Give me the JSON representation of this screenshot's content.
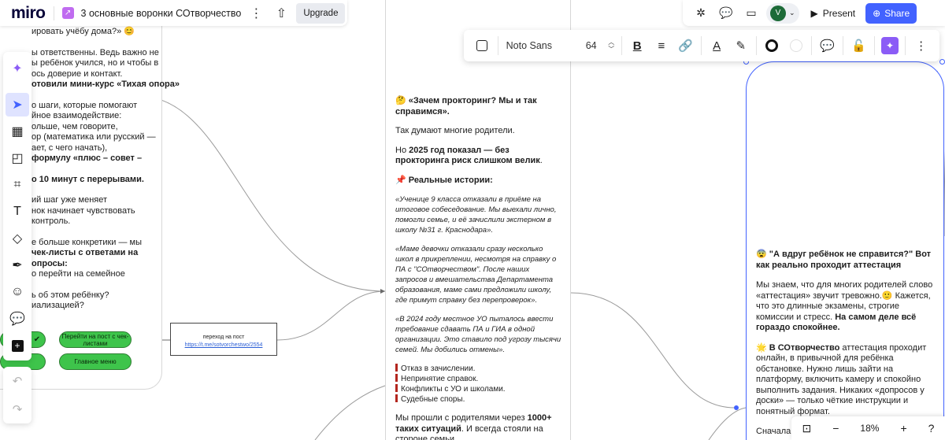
{
  "header": {
    "logo": "miro",
    "board_title": "3 основные воронки СОтворчество",
    "upgrade_label": "Upgrade"
  },
  "topbar": {
    "avatar_initial": "V",
    "present_label": "Present",
    "share_label": "Share"
  },
  "format_toolbar": {
    "font_name": "Noto Sans",
    "font_size": "64"
  },
  "canvas": {
    "left_card": {
      "lines": [
        "ировать учёбу дома?» 😊",
        "ы ответственны. Ведь важно не",
        "ы ребёнок учился, но и чтобы в",
        "ось доверие и контакт.",
        "отовили мини-курс «Тихая опора»",
        "о шаги, которые помогают",
        "йное взаимодействие:",
        "ольше, чем говорите,",
        "ор (математика или русский —",
        "ает, с чего начать),",
        "формулу «плюс – совет –",
        "о 10 минут с перерывами.",
        "ий шаг уже меняет",
        "нок начинает чувствовать",
        "контроль.",
        "е больше конкретики — мы",
        "чек-листы с ответами на",
        "опросы:",
        "о перейти на семейное",
        "ь об этом ребёнку?",
        "иализацией?"
      ],
      "btn_checklists": "Перейти на пост с чек-листами",
      "btn_main_menu": "Главное меню"
    },
    "link_box": {
      "label": "переход на пост",
      "url": "https://t.me/sotvorchestwo/2554"
    },
    "mid_card": {
      "heading": "🤔 «Зачем прокторинг? Мы и так справимся».",
      "p1": "Так думают многие родители.",
      "p2_prefix": "Но ",
      "p2_bold": "2025 год показал — без прокторинга риск слишком велик",
      "p2_suffix": ".",
      "stories_heading": "📌 Реальные истории:",
      "story1": "«Ученице 9 класса отказали в приёме на итоговое собеседование. Мы выехали лично, помогли семье, и её зачислили экстерном в школу №31 г. Краснодара».",
      "story2": "«Маме девочки отказали сразу несколько школ в прикреплении, несмотря на справку о ПА с \"СОтворчеством\". После наших запросов и вмешательства Департамента образования, маме сами предложили школу, где примут справку без перепроверок».",
      "story3": "«В 2024 году местное УО пыталось ввести требование сдавать ПА и ГИА в одной организации. Это ставило под угрозу тысячи семей. Мы добились отмены».",
      "list": [
        "Отказ в зачислении.",
        "Непринятие справок.",
        "Конфликты с УО и школами.",
        "Судебные споры."
      ],
      "closing_prefix": "Мы прошли с родителями через ",
      "closing_bold": "1000+ таких ситуаций",
      "closing_suffix": ". И всегда стояли на стороне семьи."
    },
    "right_card": {
      "heading": "😨 \"А вдруг ребёнок не справится?\" Вот как реально проходит аттестация",
      "p1": " Мы знаем, что для многих родителей слово «аттестация» звучит тревожно.🙂 Кажется, что это длинные экзамены, строгие комиссии и стресс. ",
      "p1_bold": "На самом деле всё гораздо спокойнее.",
      "p2_bold": "🌟 В СОтворчество",
      "p2": " аттестация проходит онлайн, в привычной для ребёнка обстановке. Нужно лишь зайти на платформу, включить камеру и спокойно выполнить задания. Никаких «допросов у доски» — только чёткие инструкции и понятный формат.",
      "p3": "Сначала ребёнок получает доступ к тестам и заданиям проверяет"
    }
  },
  "zoom": {
    "value": "18%"
  }
}
